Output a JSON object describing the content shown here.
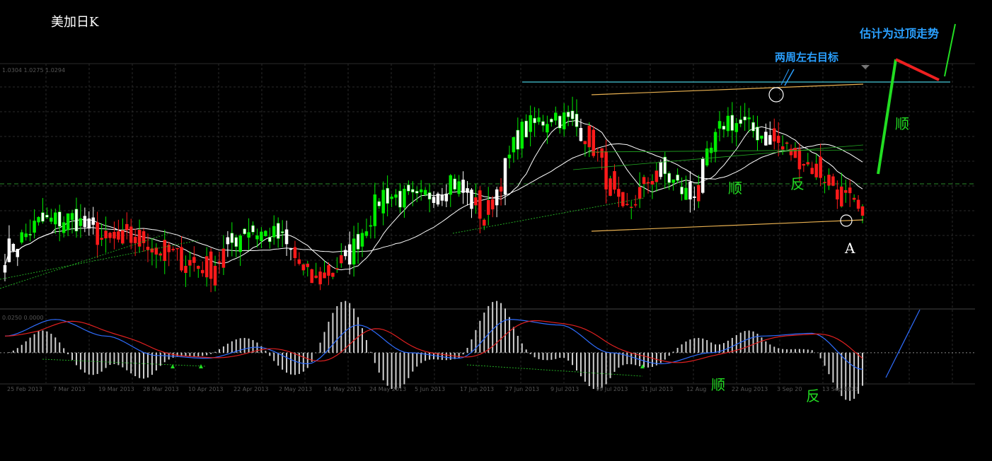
{
  "title": "美加日K",
  "price_readout": "1.0304 1.0275 1.0294",
  "macd_readout": "0.0250 0.0000",
  "annotations": {
    "estimate": "估计为过顶走势",
    "target": "两周左右目标",
    "shun_main": "顺",
    "shun_right": "顺",
    "fan_main": "反",
    "shun_macd": "顺",
    "fan_macd": "反",
    "point_a": "A"
  },
  "colors": {
    "background": "#000000",
    "bull_candle": "#00ee00",
    "bear_candle": "#ff1a1a",
    "neutral_candle": "#ffffff",
    "ma_line": "#ffffff",
    "target_line": "#3aa7b5",
    "channel_line": "#e8b050",
    "annotation_blue": "#2aa0ff",
    "annotation_green": "#22dd22",
    "macd_blue": "#2f6dff",
    "macd_red": "#e02020",
    "histogram": "#d0d0d0",
    "grid": "#2a2a2a"
  },
  "chart_data": {
    "type": "candlestick",
    "symbol": "USDCAD",
    "timeframe": "Daily",
    "x_tick_labels": [
      "25 Feb 2013",
      "7 Mar 2013",
      "19 Mar 2013",
      "28 Mar 2013",
      "10 Apr 2013",
      "22 Apr 2013",
      "2 May 2013",
      "14 May 2013",
      "24 May 2013",
      "5 Jun 2013",
      "17 Jun 2013",
      "27 Jun 2013",
      "9 Jul 2013",
      "19 Jul 2013",
      "31 Jul 2013",
      "12 Aug",
      "22 Aug 2013",
      "3 Sep 20",
      "13 Sep 2013"
    ],
    "price_path_close_approx": [
      1.018,
      1.024,
      1.025,
      1.02,
      1.021,
      1.017,
      1.015,
      1.023,
      1.021,
      1.012,
      1.017,
      1.03,
      1.028,
      1.033,
      1.025,
      1.042,
      1.046,
      1.042,
      1.025,
      1.035,
      1.029,
      1.045,
      1.042,
      1.038,
      1.033,
      1.025
    ],
    "macd_path_approx": [
      0.003,
      0.006,
      0.003,
      -0.0005,
      -0.001,
      0.001,
      -0.002,
      0.005,
      0.0,
      -0.001,
      0.006,
      0.005,
      0.0,
      -0.002,
      0.0,
      0.003,
      0.0035,
      -0.003
    ],
    "grid": true
  }
}
